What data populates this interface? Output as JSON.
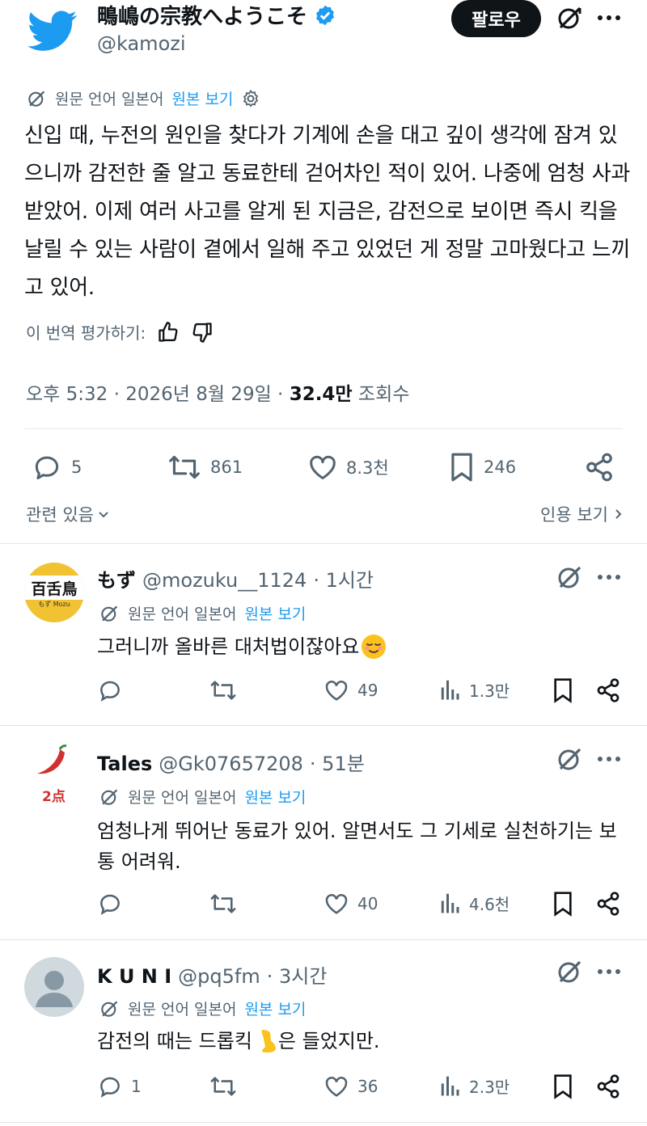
{
  "tweet": {
    "display_name": "鴫嶋の宗教へようこそ",
    "handle": "@kamozi",
    "follow_label": "팔로우",
    "translation": {
      "original_language": "원문 언어 일본어",
      "view_original": "원본 보기"
    },
    "text": "신입 때, 누전의 원인을 찾다가 기계에 손을 대고 깊이 생각에 잠겨 있으니까 감전한 줄 알고 동료한테 걷어차인 적이 있어. 나중에 엄청 사과받았어. 이제 여러 사고를 알게 된 지금은, 감전으로 보이면 즉시 킥을 날릴 수 있는 사람이 곁에서 일해 주고 있었던 게 정말 고마웠다고 느끼고 있어.",
    "rate_label": "이 번역 평가하기:",
    "time": "오후 5:32 · 2026년 8월 29일 · ",
    "views": "32.4만",
    "views_label": " 조회수",
    "stats": {
      "replies": "5",
      "reposts": "861",
      "likes": "8.3천",
      "bookmarks": "246"
    },
    "related_label": "관련 있음",
    "quotes_label": "인용 보기"
  },
  "replies": [
    {
      "name": "もず",
      "handle": "@mozuku__1124",
      "time": "· 1시간",
      "avatar_text": "百舌鳥",
      "avatar_sub": "もず  Mozu",
      "translation": {
        "original_language": "원문 언어 일본어",
        "view_original": "원본 보기"
      },
      "text": "그러니까 올바른 대처법이잖아요",
      "stats": {
        "replies": "",
        "reposts": "",
        "likes": "49",
        "views": "1.3만"
      }
    },
    {
      "name": "Tales",
      "handle": "@Gk07657208",
      "time": "· 51분",
      "avatar_text": "2点",
      "translation": {
        "original_language": "원문 언어 일본어",
        "view_original": "원본 보기"
      },
      "text": "엄청나게 뛰어난 동료가 있어. 알면서도 그 기세로 실천하기는 보통 어려워.",
      "stats": {
        "replies": "",
        "reposts": "",
        "likes": "40",
        "views": "4.6천"
      }
    },
    {
      "name": "K U N I",
      "handle": "@pq5fm",
      "time": "· 3시간",
      "translation": {
        "original_language": "원문 언어 일본어",
        "view_original": "원본 보기"
      },
      "text_before": "감전의 때는 드롭킥",
      "text_after": " 은 들었지만.",
      "stats": {
        "replies": "1",
        "reposts": "",
        "likes": "36",
        "views": "2.3만"
      }
    }
  ],
  "colors": {
    "accent": "#1d9bf0",
    "text": "#0f1419",
    "muted": "#536471",
    "divider": "#e1e4e6"
  }
}
